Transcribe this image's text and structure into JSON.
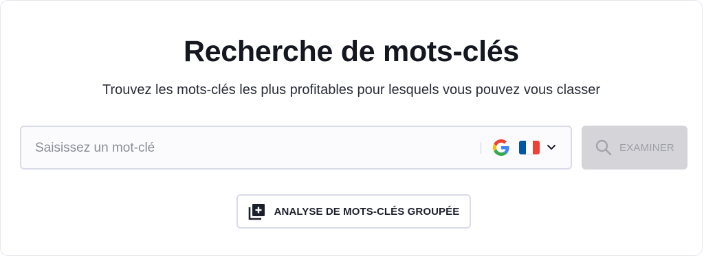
{
  "header": {
    "title": "Recherche de mots-clés",
    "subtitle": "Trouvez les mots-clés les plus profitables pour lesquels vous pouvez vous classer"
  },
  "search": {
    "placeholder": "Saisissez un mot-clé",
    "value": "",
    "engine_icon": "google-icon",
    "country_icon": "france-flag-icon",
    "dropdown_icon": "chevron-down-icon"
  },
  "actions": {
    "examine_label": "EXAMINER",
    "examine_icon": "search-icon",
    "bulk_label": "ANALYSE DE MOTS-CLÉS GROUPÉE",
    "bulk_icon": "add-layers-icon"
  },
  "colors": {
    "title_text": "#14171f",
    "examine_bg_disabled": "#d5d5d9",
    "examine_text_disabled": "#9e9fa6",
    "border": "#d9dbe8",
    "flag_blue": "#0055a4",
    "flag_white": "#ffffff",
    "flag_red": "#ef4135"
  }
}
